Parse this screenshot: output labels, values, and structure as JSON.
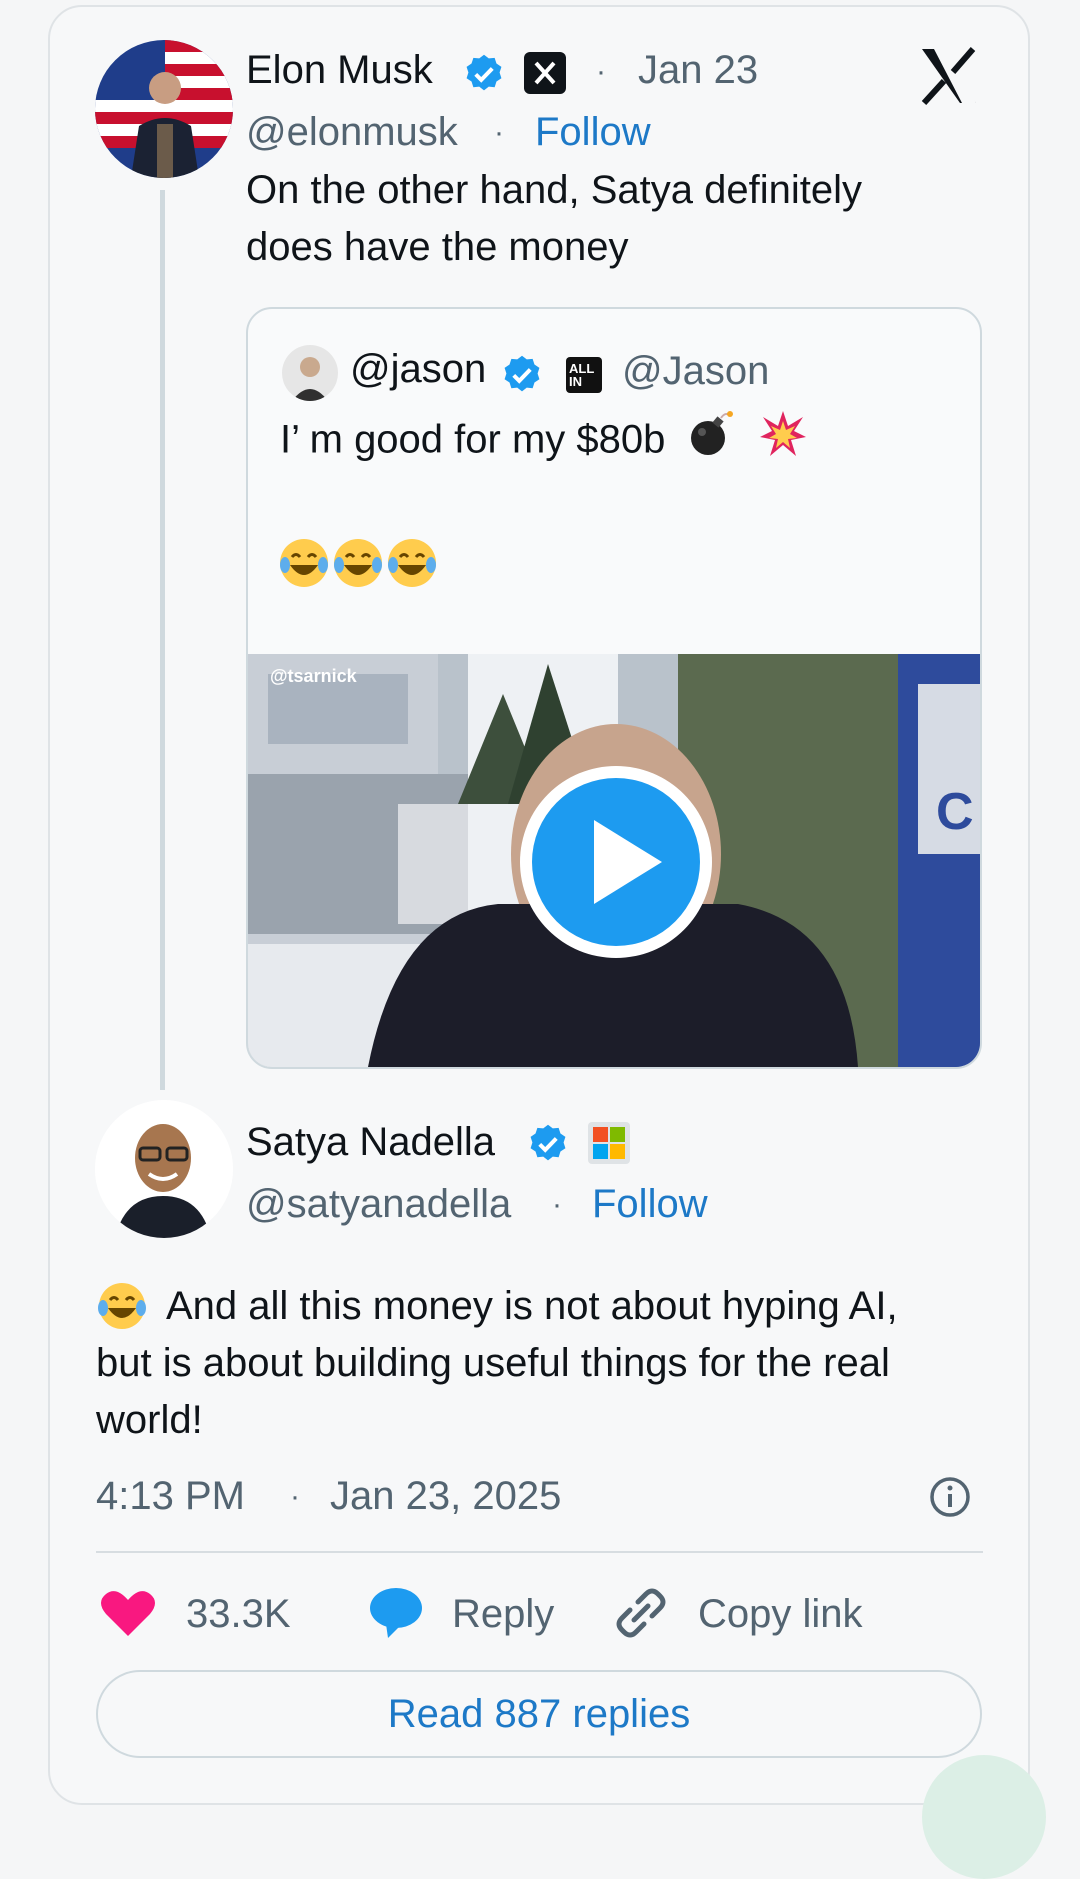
{
  "tweet": {
    "author": {
      "name": "Elon Musk",
      "handle": "@elonmusk",
      "date": "Jan 23",
      "follow": "Follow"
    },
    "text_line1": "On the other hand, Satya definitely",
    "text_line2": "does have the money",
    "quote": {
      "handle": "@jason",
      "badge": "ALL IN",
      "alt_handle": "@Jason",
      "text": "I’ m good for my $80b",
      "emojis": "😂😂😂",
      "video_watermark": "@tsarnick",
      "video_sign": "C"
    }
  },
  "reply": {
    "author": {
      "name": "Satya Nadella",
      "handle": "@satyanadella",
      "follow": "Follow"
    },
    "line1": "And all this money is not about hyping AI,",
    "line2": "but is about building useful things for the real",
    "line3": "world!",
    "time": "4:13 PM",
    "date": "Jan 23, 2025"
  },
  "actions": {
    "likes": "33.3K",
    "reply": "Reply",
    "copy_link": "Copy link",
    "read_replies": "Read 887 replies"
  },
  "icons": {
    "verified": "verified-badge-icon",
    "x_logo": "x-logo-icon",
    "heart": "heart-icon",
    "reply": "speech-bubble-icon",
    "link": "link-icon",
    "info": "info-icon",
    "play": "play-icon"
  },
  "colors": {
    "accent": "#1d79c7",
    "verified": "#1d9bf0",
    "heart": "#f91880",
    "text": "#0f1419",
    "muted": "#536471"
  }
}
